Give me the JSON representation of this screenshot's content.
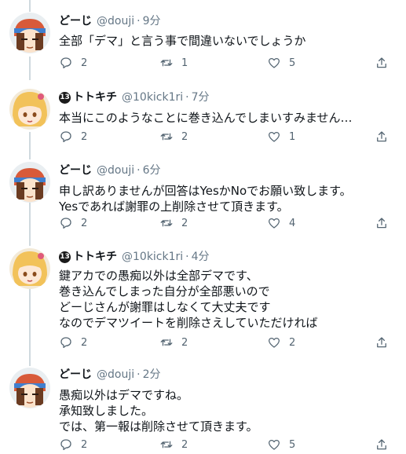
{
  "tweets": [
    {
      "author": "どーじ",
      "handle": "@douji",
      "time": "9分",
      "badge": "",
      "lines": [
        "全部「デマ」と言う事で間違いないでしょうか"
      ],
      "replies": "2",
      "retweets": "1",
      "likes": "5"
    },
    {
      "author": "トトキチ",
      "handle": "@10kick1ri",
      "time": "7分",
      "badge": "13",
      "lines": [
        "本当にこのようなことに巻き込んでしまいすみません…"
      ],
      "replies": "2",
      "retweets": "2",
      "likes": "1"
    },
    {
      "author": "どーじ",
      "handle": "@douji",
      "time": "6分",
      "badge": "",
      "lines": [
        "申し訳ありませんが回答はYesかNoでお願い致します。",
        "Yesであれば謝罪の上削除させて頂きます。"
      ],
      "replies": "2",
      "retweets": "2",
      "likes": "4"
    },
    {
      "author": "トトキチ",
      "handle": "@10kick1ri",
      "time": "4分",
      "badge": "13",
      "lines": [
        "鍵アカでの愚痴以外は全部デマです、",
        "巻き込んでしまった自分が全部悪いので",
        "どーじさんが謝罪はしなくて大丈夫です",
        "なのでデマツイートを削除さえしていただければ"
      ],
      "replies": "2",
      "retweets": "2",
      "likes": "2"
    },
    {
      "author": "どーじ",
      "handle": "@douji",
      "time": "2分",
      "badge": "",
      "lines": [
        "愚痴以外はデマですね。",
        "承知致しました。",
        "では、第一報は削除させて頂きます。"
      ],
      "replies": "2",
      "retweets": "2",
      "likes": "5"
    }
  ],
  "separator": "·",
  "icons": [
    "reply-icon",
    "retweet-icon",
    "like-icon",
    "share-icon"
  ],
  "colors": {
    "text": "#0f1419",
    "muted": "#657786",
    "thread_line": "#cfd9de"
  }
}
